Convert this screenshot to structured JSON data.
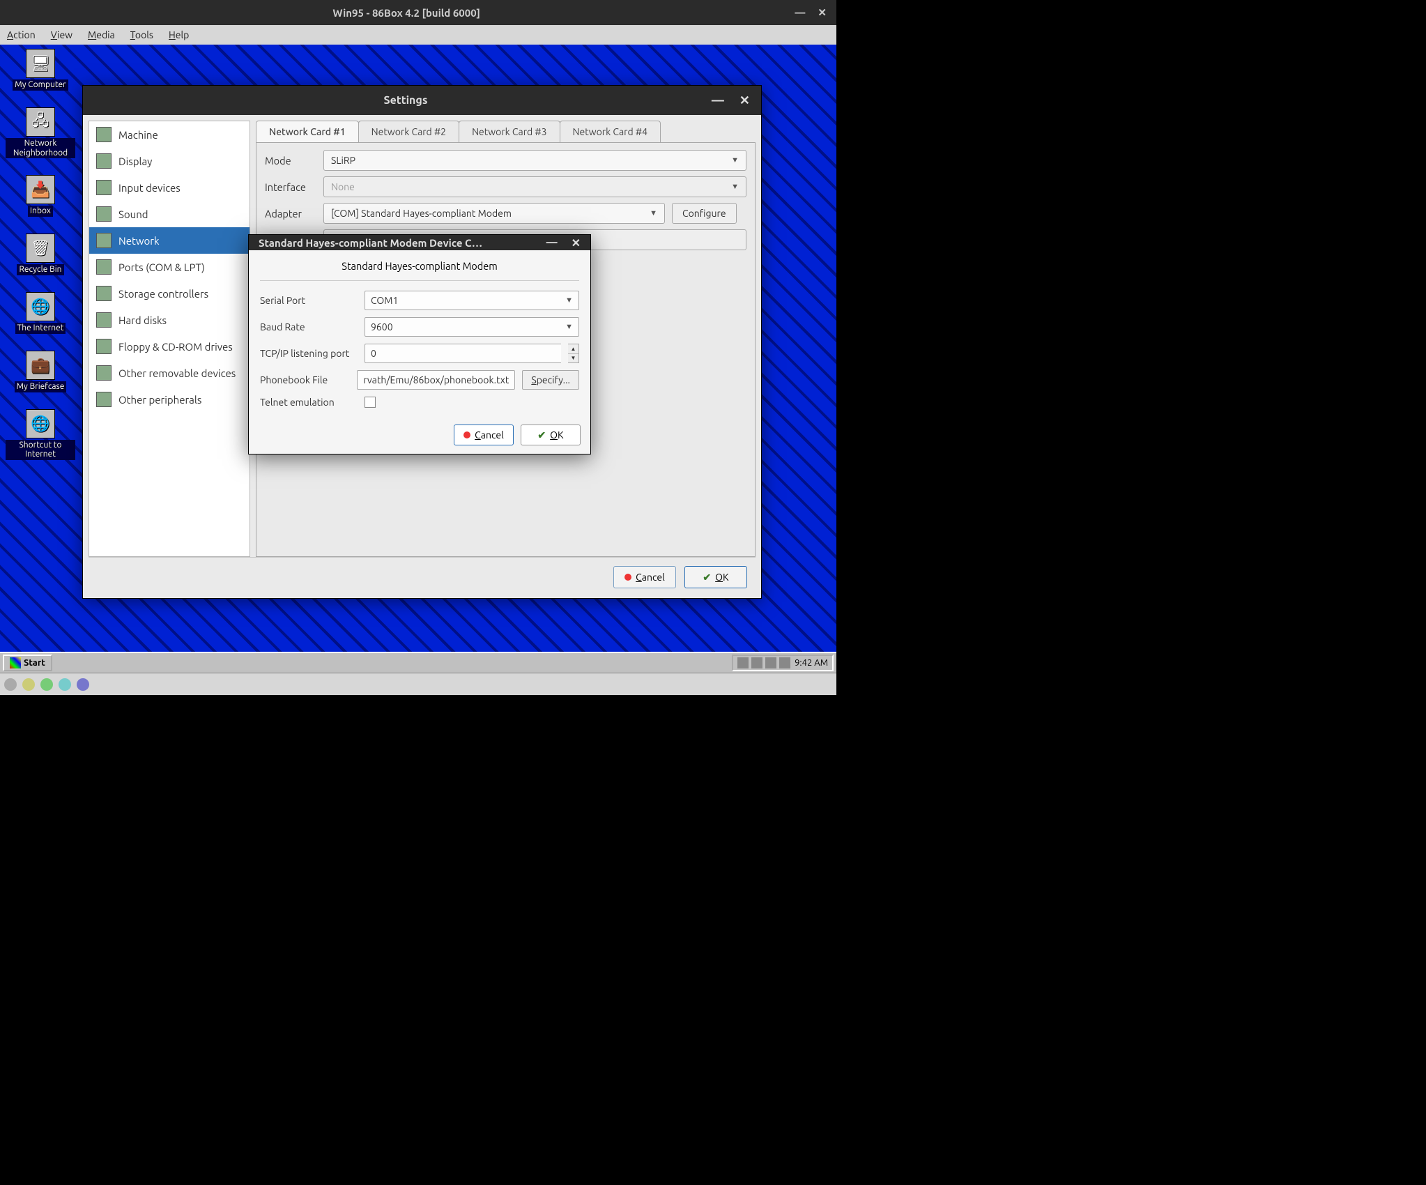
{
  "host": {
    "title": "Win95 - 86Box 4.2 [build 6000]",
    "menu": {
      "action": "Action",
      "view": "View",
      "media": "Media",
      "tools": "Tools",
      "help": "Help"
    }
  },
  "desktop": {
    "icons": [
      "My Computer",
      "Network Neighborhood",
      "Inbox",
      "Recycle Bin",
      "The Internet",
      "My Briefcase",
      "Shortcut to Internet"
    ]
  },
  "taskbar": {
    "start": "Start",
    "clock": "9:42 AM"
  },
  "settings": {
    "title": "Settings",
    "sidebar": [
      "Machine",
      "Display",
      "Input devices",
      "Sound",
      "Network",
      "Ports (COM & LPT)",
      "Storage controllers",
      "Hard disks",
      "Floppy & CD-ROM drives",
      "Other removable devices",
      "Other peripherals"
    ],
    "selected_sidebar_index": 4,
    "tabs": [
      "Network Card #1",
      "Network Card #2",
      "Network Card #3",
      "Network Card #4"
    ],
    "active_tab_index": 0,
    "labels": {
      "mode": "Mode",
      "interface": "Interface",
      "adapter": "Adapter"
    },
    "mode_value": "SLiRP",
    "interface_value": "None",
    "adapter_value": "[COM] Standard Hayes-compliant Modem",
    "configure_btn": "Configure",
    "cancel_btn": "Cancel",
    "ok_btn": "OK"
  },
  "modal": {
    "title": "Standard Hayes-compliant Modem Device C…",
    "subtitle": "Standard Hayes-compliant Modem",
    "labels": {
      "serial_port": "Serial Port",
      "baud_rate": "Baud Rate",
      "tcp_port": "TCP/IP listening port",
      "phonebook": "Phonebook File",
      "telnet": "Telnet emulation"
    },
    "serial_port_value": "COM1",
    "baud_rate_value": "9600",
    "tcp_port_value": "0",
    "phonebook_value": "rvath/Emu/86box/phonebook.txt",
    "specify_btn": "Specify...",
    "cancel_btn": "Cancel",
    "ok_btn": "OK",
    "telnet_checked": false
  }
}
